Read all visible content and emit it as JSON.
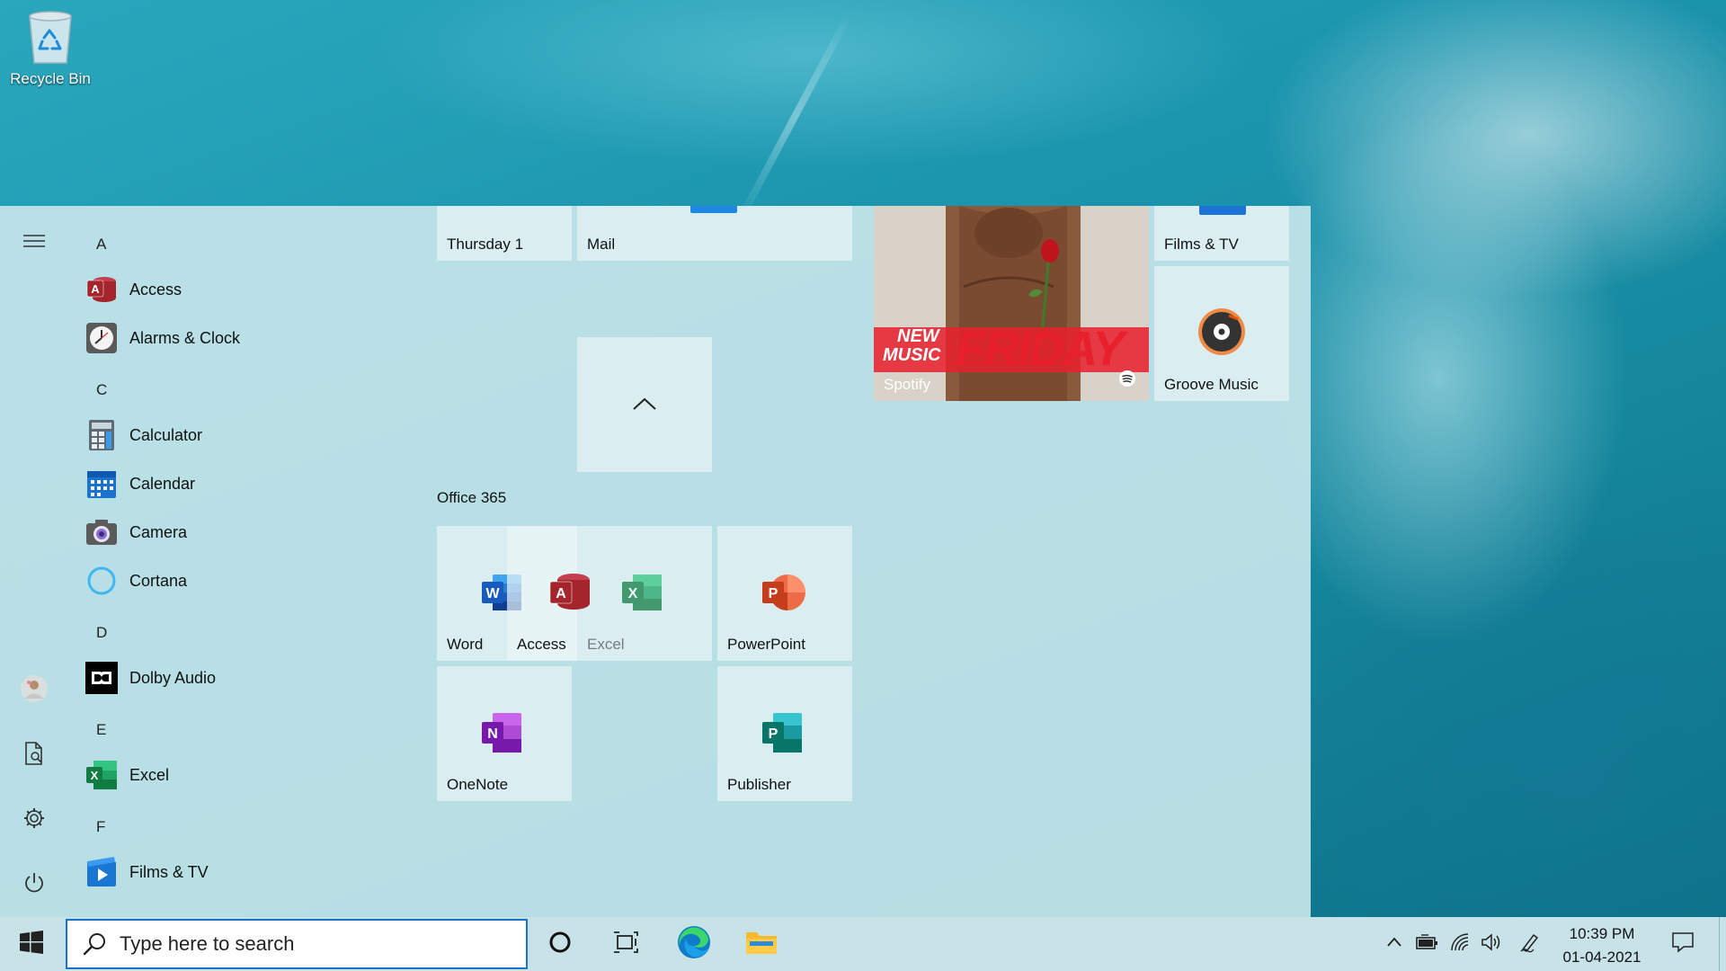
{
  "desktop": {
    "icons": [
      {
        "label": "Recycle Bin",
        "icon": "recycle-bin-icon"
      }
    ]
  },
  "start_menu": {
    "rail": {
      "items": [
        {
          "name": "expand-menu",
          "icon": "hamburger-icon"
        },
        {
          "name": "user-account",
          "icon": "avatar"
        },
        {
          "name": "documents",
          "icon": "document-icon"
        },
        {
          "name": "settings",
          "icon": "gear-icon"
        },
        {
          "name": "power",
          "icon": "power-icon"
        }
      ]
    },
    "app_list": {
      "groups": [
        {
          "letter": "A",
          "apps": [
            {
              "label": "Access",
              "icon": "access-icon"
            },
            {
              "label": "Alarms & Clock",
              "icon": "clock-icon"
            }
          ]
        },
        {
          "letter": "C",
          "apps": [
            {
              "label": "Calculator",
              "icon": "calculator-icon"
            },
            {
              "label": "Calendar",
              "icon": "calendar-icon"
            },
            {
              "label": "Camera",
              "icon": "camera-icon"
            },
            {
              "label": "Cortana",
              "icon": "cortana-icon"
            }
          ]
        },
        {
          "letter": "D",
          "apps": [
            {
              "label": "Dolby Audio",
              "icon": "dolby-icon"
            }
          ]
        },
        {
          "letter": "E",
          "apps": [
            {
              "label": "Excel",
              "icon": "excel-icon"
            }
          ]
        },
        {
          "letter": "F",
          "apps": [
            {
              "label": "Films & TV",
              "icon": "films-tv-icon"
            }
          ]
        }
      ]
    },
    "tiles": {
      "calendar_tile": "Thursday 1",
      "mail_tile": "Mail",
      "spotify_tile": "Spotify",
      "spotify_banner_top": "NEW",
      "spotify_banner_bottom": "MUSIC",
      "spotify_banner_main": "FRIDAY",
      "films_tile": "Films & TV",
      "groove_tile": "Groove Music",
      "office_group_title": "Office 365",
      "office_folder": [
        {
          "label": "Word",
          "icon": "word-icon"
        },
        {
          "label": "Access",
          "icon": "access-icon"
        },
        {
          "label": "Excel",
          "icon": "excel-icon"
        }
      ],
      "powerpoint_tile": "PowerPoint",
      "onenote_tile": "OneNote",
      "publisher_tile": "Publisher"
    }
  },
  "taskbar": {
    "search_placeholder": "Type here to search",
    "clock_time": "10:39 PM",
    "clock_date": "01-04-2021",
    "pinned": [
      {
        "name": "cortana",
        "icon": "cortana-ring-icon"
      },
      {
        "name": "task-view",
        "icon": "task-view-icon"
      },
      {
        "name": "edge",
        "icon": "edge-icon"
      },
      {
        "name": "file-explorer",
        "icon": "folder-icon"
      }
    ],
    "tray": [
      "chevron-up-icon",
      "battery-icon",
      "wifi-icon",
      "volume-icon",
      "pen-icon"
    ]
  }
}
